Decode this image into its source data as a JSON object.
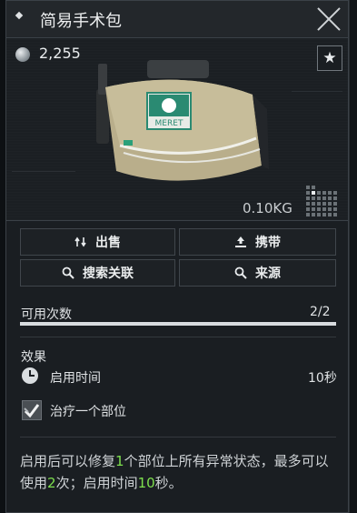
{
  "window": {
    "title": "简易手术包",
    "close_icon": "close-x-icon"
  },
  "item": {
    "price": "2,255",
    "price_icon": "rouble-coin-icon",
    "favorite_icon": "star-icon",
    "favorite_glyph": "★",
    "weight": "0.10KG",
    "size_icon": "slot-grid-icon",
    "image_label": "MERET"
  },
  "actions": {
    "sell_label": "出售",
    "carry_label": "携带",
    "search_related_label": "搜索关联",
    "source_label": "来源"
  },
  "uses": {
    "label": "可用次数",
    "value": "2/2",
    "fraction": 1.0
  },
  "effects": {
    "title": "效果",
    "items": [
      {
        "icon": "clock-icon",
        "label": "启用时间",
        "value": "10秒"
      },
      {
        "icon": "heal-icon",
        "label": "治疗一个部位",
        "value": ""
      }
    ]
  },
  "description": {
    "prefix": "启用后可以修复",
    "parts_count": "1",
    "middle": "个部位上所有异常状态，最多可以使用",
    "use_count": "2",
    "middle2": "次；启用时间",
    "time_value": "10",
    "suffix": "秒。",
    "highlight_color": "#7ee04e"
  }
}
